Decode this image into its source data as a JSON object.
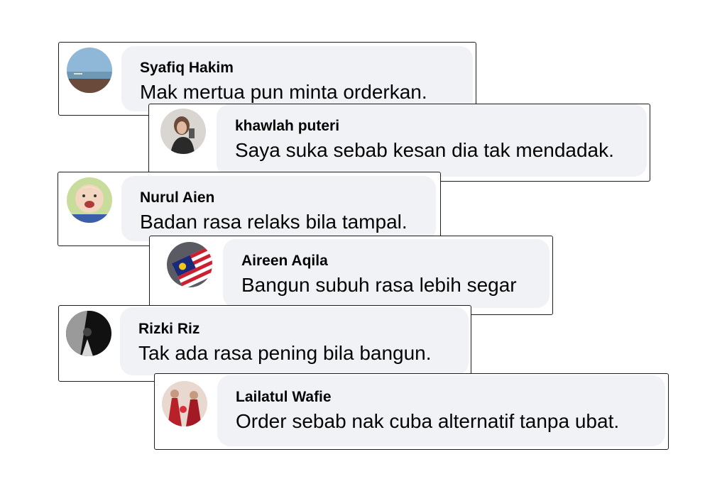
{
  "comments": [
    {
      "name": "Syafiq Hakim",
      "text": "Mak mertua pun minta orderkan.",
      "avatar_icon": "beach-landscape-avatar"
    },
    {
      "name": "khawlah puteri",
      "text": "Saya suka sebab kesan dia tak mendadak.",
      "avatar_icon": "woman-selfie-avatar"
    },
    {
      "name": "Nurul Aien",
      "text": "Badan rasa relaks bila tampal.",
      "avatar_icon": "smiling-baby-avatar"
    },
    {
      "name": "Aireen Aqila",
      "text": "Bangun subuh rasa lebih segar",
      "avatar_icon": "malaysia-flag-avatar"
    },
    {
      "name": "Rizki Riz",
      "text": "Tak ada rasa pening bila bangun.",
      "avatar_icon": "dark-figure-avatar"
    },
    {
      "name": "Lailatul Wafie",
      "text": "Order sebab nak cuba alternatif tanpa ubat.",
      "avatar_icon": "red-dress-avatar"
    }
  ],
  "colors": {
    "bubble": "#f0f2f5",
    "card_border": "#1c1c1c",
    "text": "#050505"
  }
}
